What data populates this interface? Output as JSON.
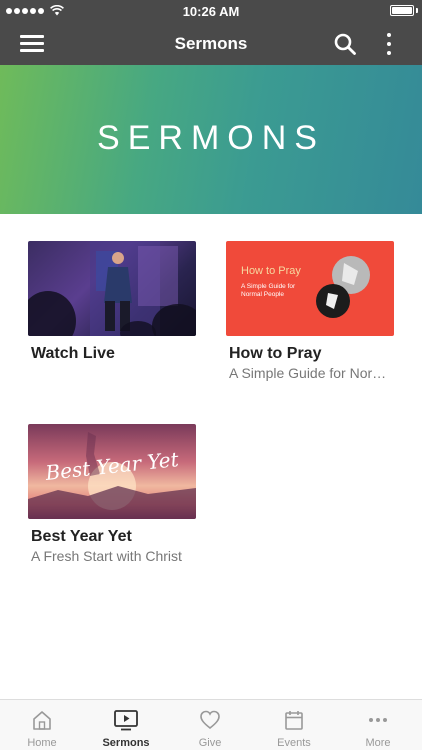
{
  "status_bar": {
    "time": "10:26 AM"
  },
  "nav": {
    "title": "Sermons"
  },
  "banner": {
    "title": "SERMONS"
  },
  "cards": [
    {
      "title": "Watch Live",
      "subtitle": ""
    },
    {
      "title": "How to Pray",
      "subtitle": "A Simple Guide for Normal People",
      "thumb_title": "How to Pray",
      "thumb_subtitle": "A Simple Guide for Normal People"
    },
    {
      "title": "Best Year Yet",
      "subtitle": "A Fresh Start with Christ",
      "thumb_title": "Best Year Yet"
    }
  ],
  "tabs": [
    {
      "label": "Home",
      "icon": "home-icon"
    },
    {
      "label": "Sermons",
      "icon": "video-icon",
      "active": true
    },
    {
      "label": "Give",
      "icon": "heart-icon"
    },
    {
      "label": "Events",
      "icon": "calendar-icon"
    },
    {
      "label": "More",
      "icon": "more-dots-icon"
    }
  ],
  "colors": {
    "header": "#4a4a4a",
    "banner_start": "#6fbb5a",
    "banner_end": "#358a98",
    "pray_red": "#f04a3a"
  }
}
